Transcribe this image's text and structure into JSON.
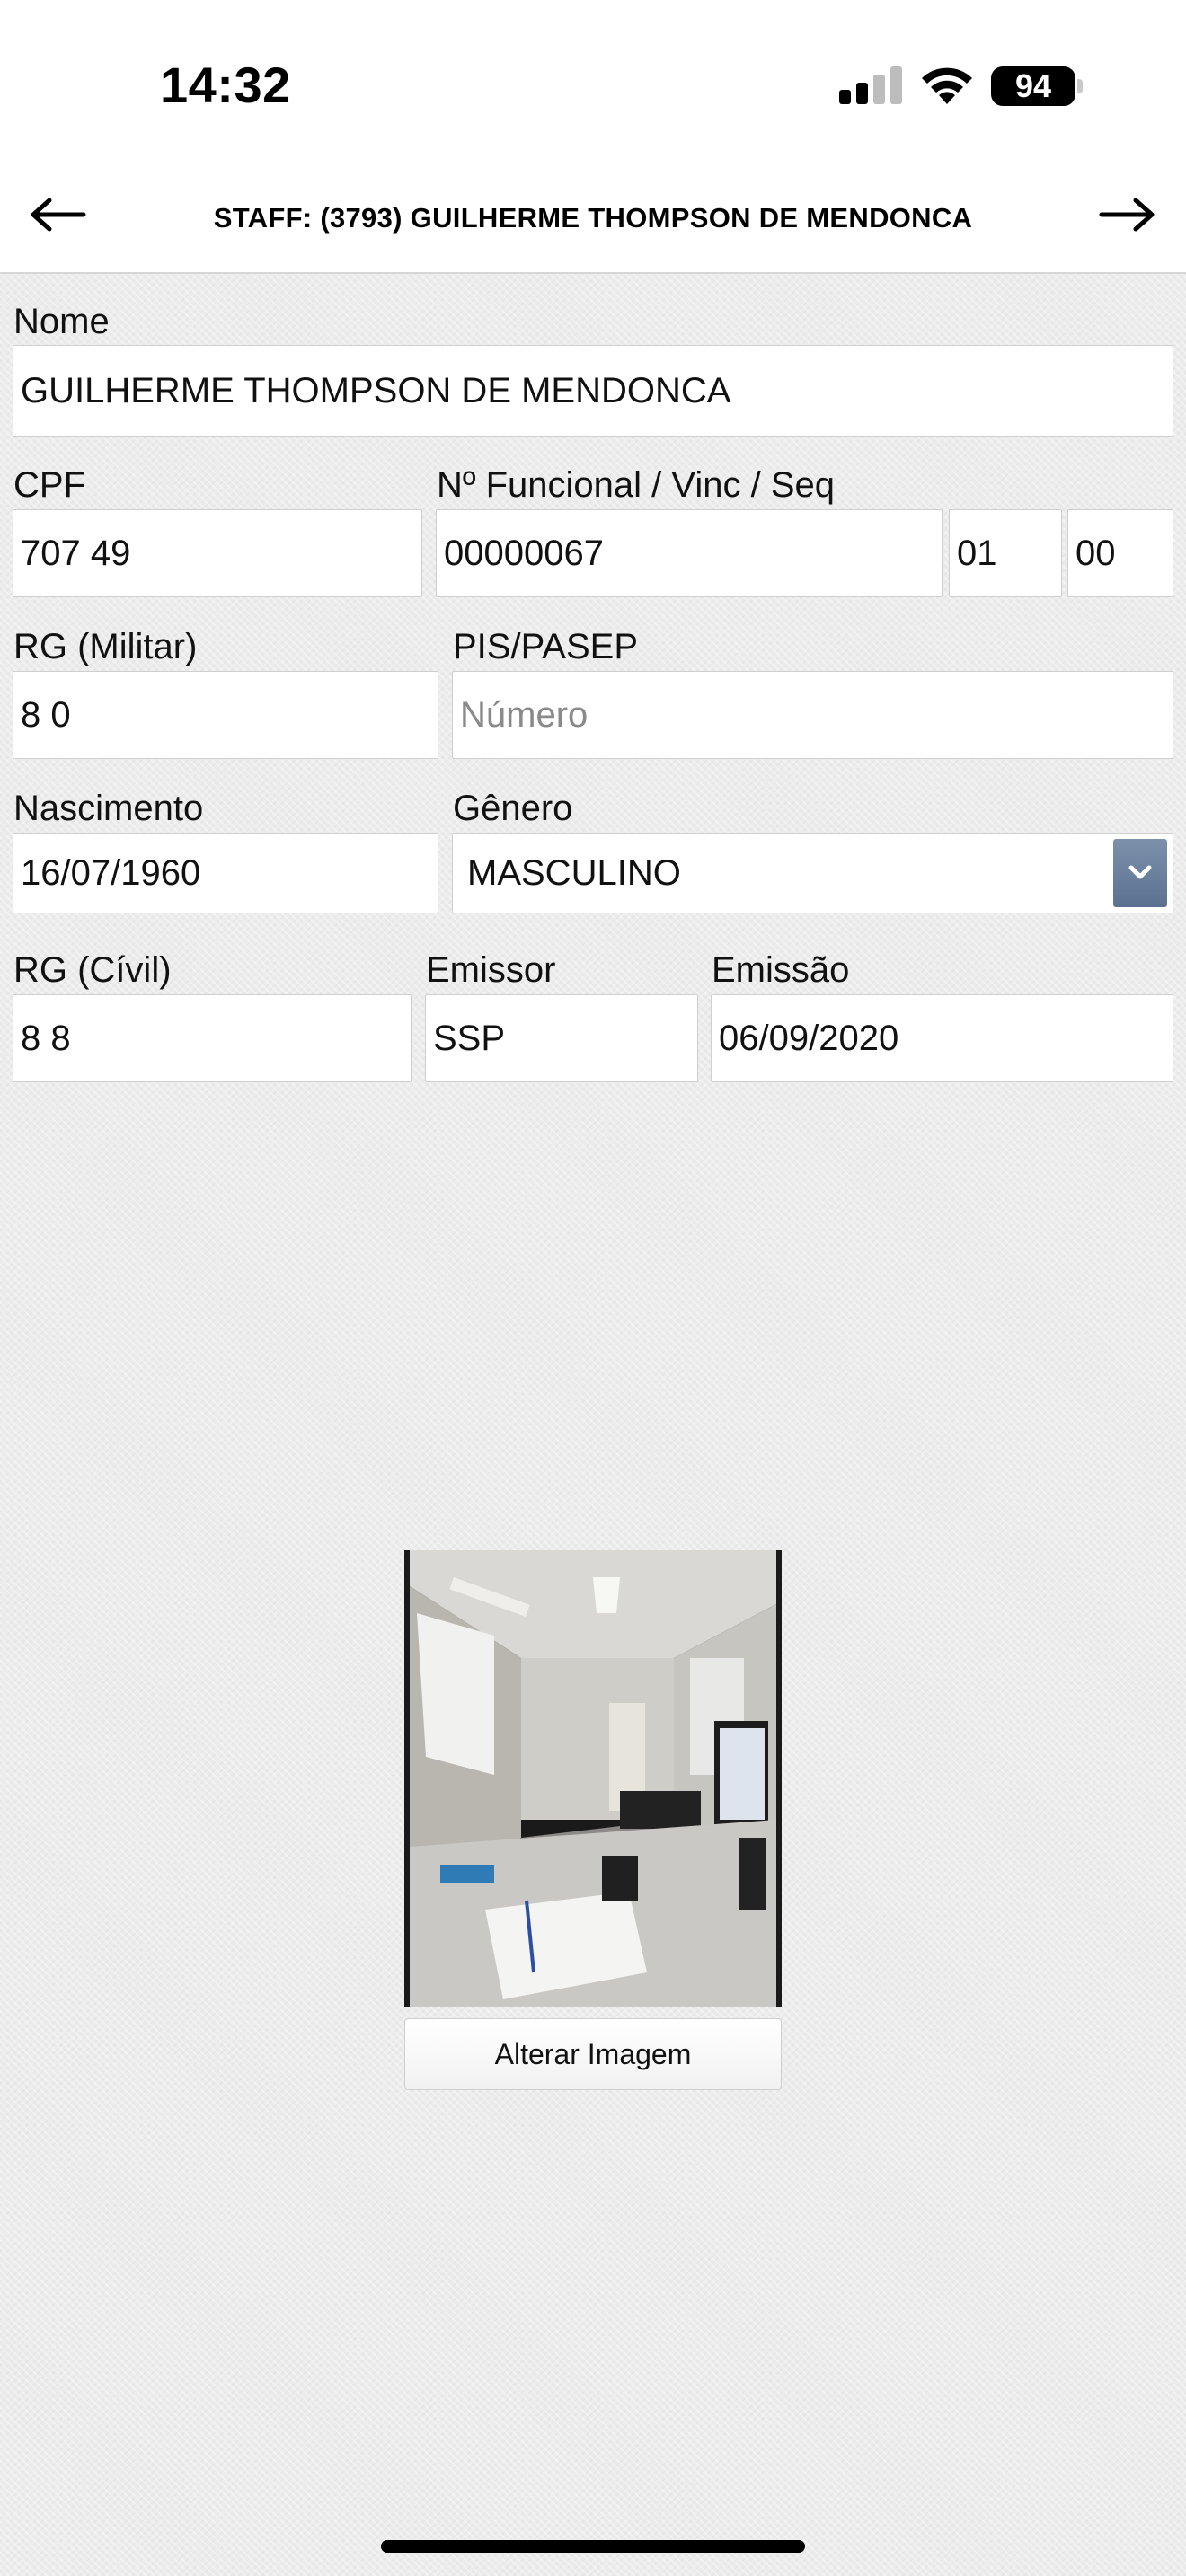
{
  "status_bar": {
    "time": "14:32",
    "battery": "94",
    "icons": [
      "cellular-signal-icon",
      "wifi-icon",
      "battery-icon"
    ]
  },
  "header": {
    "title": "STAFF: (3793) GUILHERME THOMPSON DE MENDONCA",
    "back_icon": "arrow-left-icon",
    "forward_icon": "arrow-right-icon"
  },
  "form": {
    "nome": {
      "label": "Nome",
      "value": "GUILHERME THOMPSON DE MENDONCA"
    },
    "cpf": {
      "label": "CPF",
      "value": "707 49"
    },
    "funcional": {
      "label": "Nº Funcional / Vinc / Seq",
      "number": "00000067",
      "vinc": "01",
      "seq": "00"
    },
    "rg_militar": {
      "label": "RG (Militar)",
      "value": "8 0"
    },
    "pis_pasep": {
      "label": "PIS/PASEP",
      "value": "",
      "placeholder": "Número"
    },
    "nascimento": {
      "label": "Nascimento",
      "value": "16/07/1960"
    },
    "genero": {
      "label": "Gênero",
      "value": "MASCULINO",
      "arrow_icon": "chevron-down-icon"
    },
    "rg_civil": {
      "label": "RG (Cívil)",
      "value": "8 8"
    },
    "emissor": {
      "label": "Emissor",
      "value": "SSP"
    },
    "emissao": {
      "label": "Emissão",
      "value": "06/09/2020"
    }
  },
  "photo": {
    "change_button_label": "Alterar Imagem"
  },
  "colors": {
    "select_accent": "#5b7190",
    "background": "#ececec",
    "header_bg": "#ffffff"
  }
}
